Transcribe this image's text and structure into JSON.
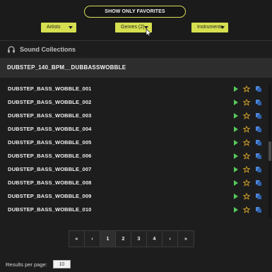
{
  "toolbar": {
    "favorites_label": "SHOW ONLY FAVORITES",
    "filters": [
      {
        "label": "Artists"
      },
      {
        "label": "Genres (2)"
      },
      {
        "label": "Instruments"
      }
    ]
  },
  "section": {
    "title": "Sound Collections",
    "icon": "headphones-icon"
  },
  "folder": {
    "title": "DUBSTEP_140_BPM__DUBBASSWOBBLE"
  },
  "items": [
    {
      "label": "DUBSTEP_BASS_WOBBLE_001"
    },
    {
      "label": "DUBSTEP_BASS_WOBBLE_002"
    },
    {
      "label": "DUBSTEP_BASS_WOBBLE_003"
    },
    {
      "label": "DUBSTEP_BASS_WOBBLE_004"
    },
    {
      "label": "DUBSTEP_BASS_WOBBLE_005"
    },
    {
      "label": "DUBSTEP_BASS_WOBBLE_006"
    },
    {
      "label": "DUBSTEP_BASS_WOBBLE_007"
    },
    {
      "label": "DUBSTEP_BASS_WOBBLE_008"
    },
    {
      "label": "DUBSTEP_BASS_WOBBLE_009"
    },
    {
      "label": "DUBSTEP_BASS_WOBBLE_010"
    }
  ],
  "pagination": {
    "first": "«",
    "prev": "‹",
    "pages": [
      "1",
      "2",
      "3",
      "4"
    ],
    "next": "›",
    "last": "»",
    "active_page": "1"
  },
  "results_per_page": {
    "label": "Results per page:",
    "value": "10"
  },
  "colors": {
    "accent": "#d6df4f",
    "play": "#55c95c",
    "star": "#d9a52a",
    "copy": "#4d86d8",
    "background": "#1d1d1d"
  }
}
